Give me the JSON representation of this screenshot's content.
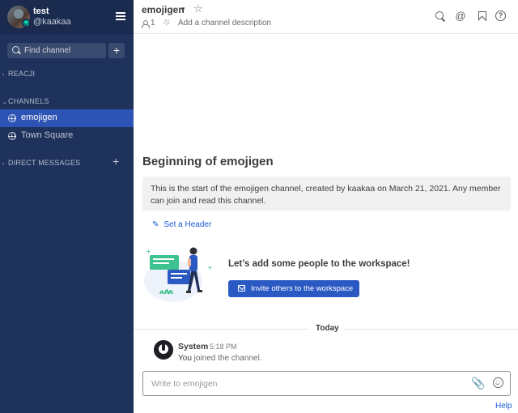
{
  "sidebar": {
    "user_name": "test",
    "user_handle": "@kaakaa",
    "find_placeholder": "Find channel",
    "add_label": "+",
    "categories": {
      "reacji": "REACJI",
      "channels": "CHANNELS",
      "direct_messages": "DIRECT MESSAGES",
      "dm_add": "+"
    },
    "channels": [
      {
        "label": "emojigen",
        "active": true
      },
      {
        "label": "Town Square",
        "active": false
      }
    ],
    "colors": {
      "sidebar_bg": "#1e325c",
      "header_bg": "#1a2b4f",
      "active_item": "#2d54b4",
      "online": "#06d6a0"
    }
  },
  "header": {
    "channel_name": "emojigen",
    "member_count": "1",
    "add_description": "Add a channel description",
    "icons": [
      "star-icon",
      "members-icon",
      "pin-icon",
      "search-icon",
      "at-mention-icon",
      "saved-flag-icon",
      "help-icon"
    ]
  },
  "intro": {
    "title": "Beginning of emojigen",
    "description": "This is the start of the emojigen channel, created by kaakaa on March 21, 2021. Any member can join and read this channel.",
    "set_header": "Set a Header",
    "add_people_title": "Let’s add some people to the workspace!",
    "invite_button": "Invite others to the workspace"
  },
  "date_separator": "Today",
  "post": {
    "author": "System",
    "time": "5:18 PM",
    "message_prefix": "You",
    "message_rest": " joined the channel."
  },
  "composer": {
    "placeholder": "Write to emojigen"
  },
  "footer": {
    "help_link": "Help"
  },
  "accent_color": "#2b59c3",
  "link_color": "#1c58d9"
}
